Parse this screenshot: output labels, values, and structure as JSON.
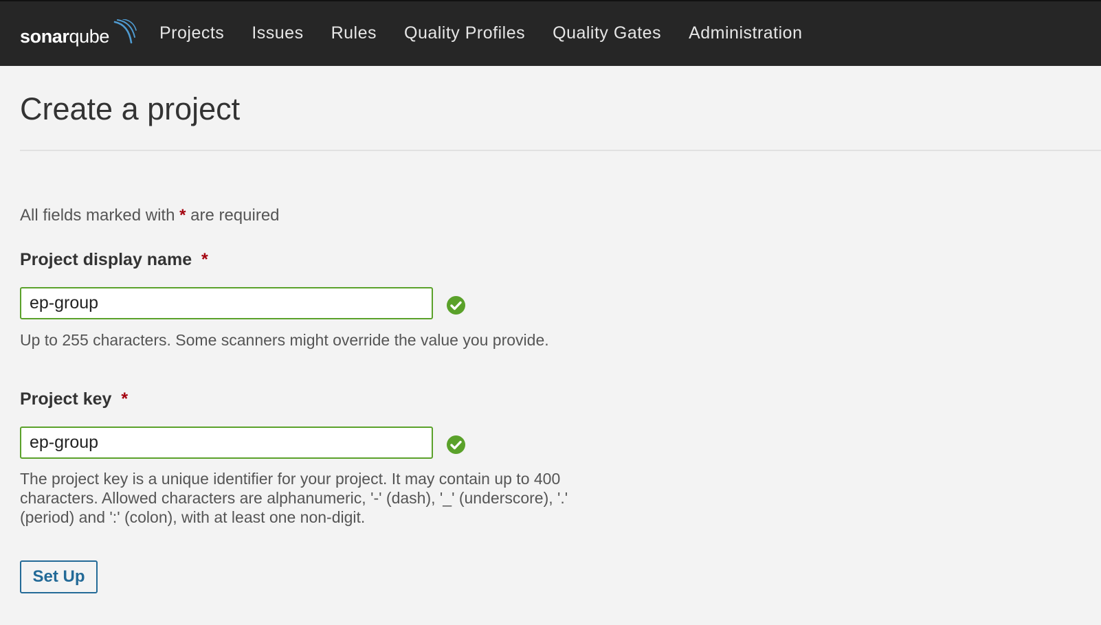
{
  "header": {
    "logo": {
      "bold": "sonar",
      "regular": "qube"
    },
    "nav": [
      {
        "label": "Projects"
      },
      {
        "label": "Issues"
      },
      {
        "label": "Rules"
      },
      {
        "label": "Quality Profiles"
      },
      {
        "label": "Quality Gates"
      },
      {
        "label": "Administration"
      }
    ]
  },
  "page": {
    "title": "Create a project",
    "required_note_prefix": "All fields marked with",
    "required_marker": "*",
    "required_note_suffix": "are required"
  },
  "form": {
    "display_name": {
      "label": "Project display name",
      "value": "ep-group",
      "help": "Up to 255 characters. Some scanners might override the value you provide.",
      "status_icon": "check-circle-icon"
    },
    "project_key": {
      "label": "Project key",
      "value": "ep-group",
      "help": "The project key is a unique identifier for your project. It may contain up to 400 characters. Allowed characters are alphanumeric, '-' (dash), '_' (underscore), '.' (period) and ':' (colon), with at least one non-digit.",
      "status_icon": "check-circle-icon"
    },
    "submit_label": "Set Up"
  },
  "colors": {
    "topbar": "#262626",
    "valid_green": "#5aa12a",
    "required_red": "#a4030f",
    "button_blue": "#236a97"
  }
}
